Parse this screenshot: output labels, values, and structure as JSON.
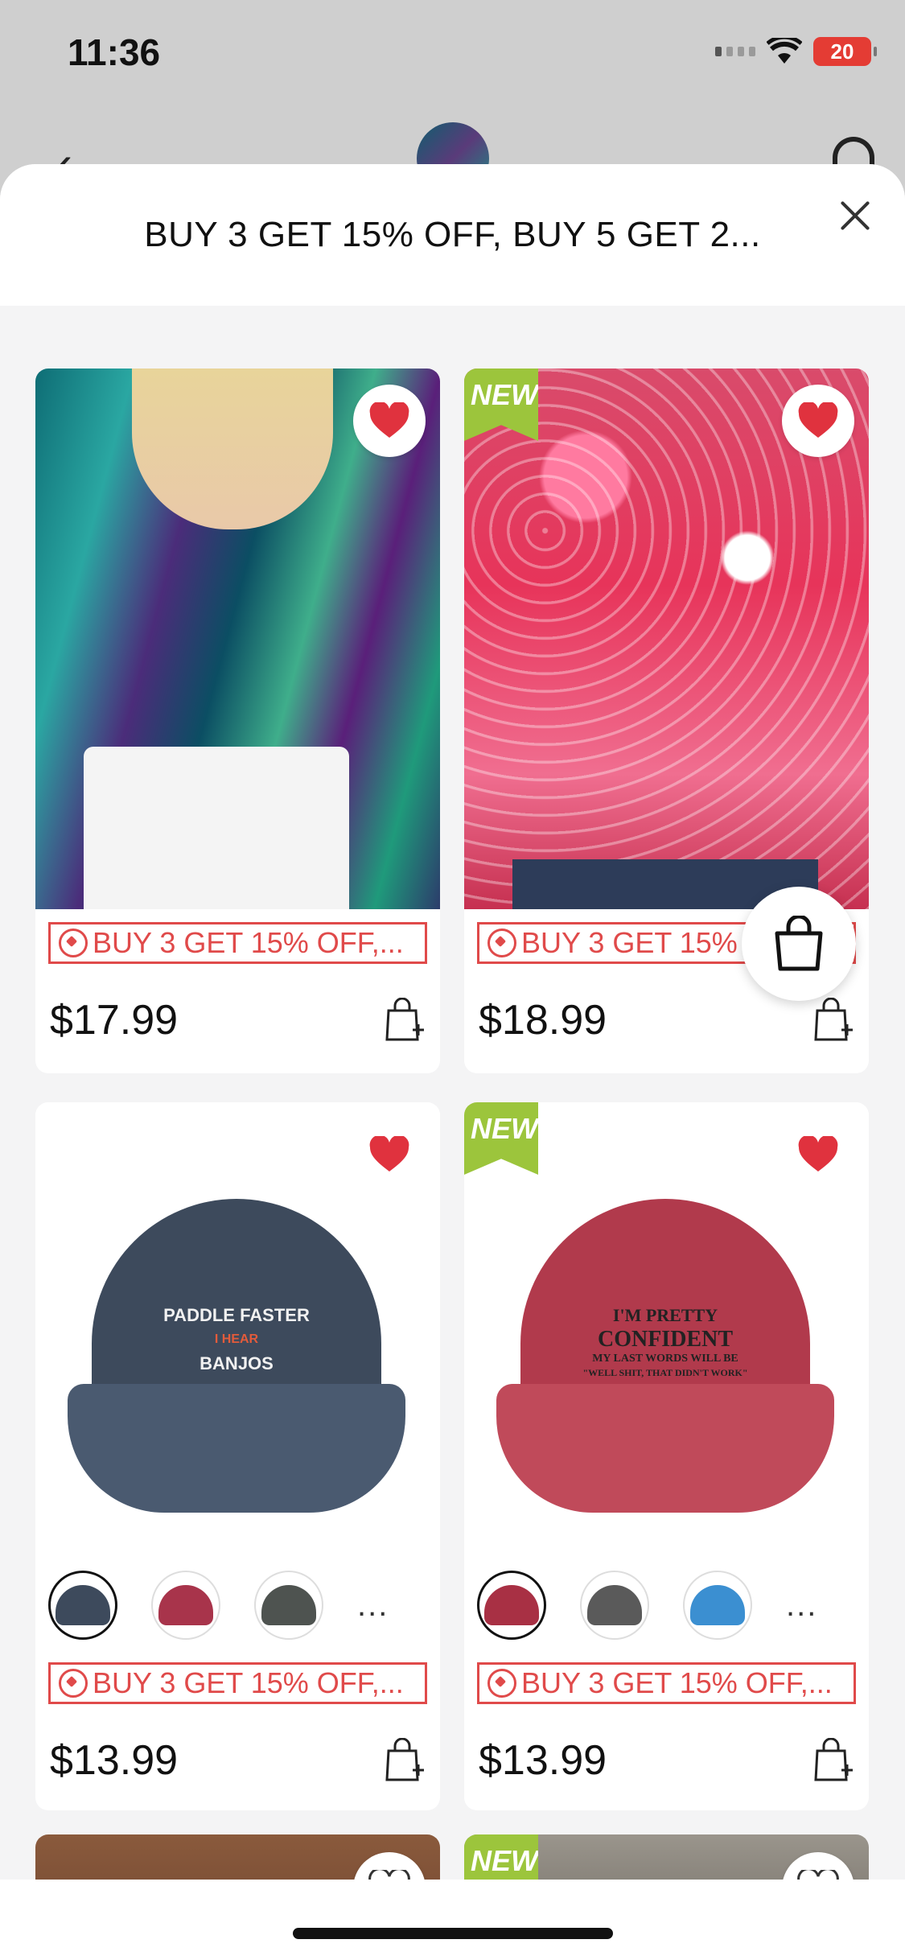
{
  "status_bar": {
    "time": "11:36",
    "battery": "20"
  },
  "sheet": {
    "title": "BUY 3 GET 15% OFF, BUY 5 GET 2..."
  },
  "products": [
    {
      "new": false,
      "promo": "BUY 3 GET 15% OFF,...",
      "price": "$17.99"
    },
    {
      "new": true,
      "new_label": "NEW",
      "promo": "BUY 3 GET 15% OFF,...",
      "price": "$18.99"
    },
    {
      "new": false,
      "promo": "BUY 3 GET 15% OFF,...",
      "price": "$13.99",
      "cap_text": [
        "PADDLE FASTER",
        "I HEAR",
        "BANJOS"
      ],
      "swatches": [
        "#3d4a5c",
        "#a8344b",
        "#4e5350"
      ],
      "more": "..."
    },
    {
      "new": true,
      "new_label": "NEW",
      "promo": "BUY 3 GET 15% OFF,...",
      "price": "$13.99",
      "cap_text": [
        "I'M PRETTY",
        "CONFIDENT",
        "MY LAST WORDS WILL BE",
        "\"WELL SHIT, THAT DIDN'T WORK\""
      ],
      "swatches": [
        "#a83044",
        "#5a5a5a",
        "#3b8fd1"
      ],
      "more": "..."
    }
  ],
  "next_row": {
    "new_label": "NEW"
  },
  "colors": {
    "promo_red": "#e04a4a",
    "heart_red": "#e0323e",
    "new_green": "#9cc53c"
  },
  "icons": [
    "back-arrow-icon",
    "headset-icon",
    "close-icon",
    "heart-icon",
    "add-to-cart-icon",
    "shopping-bag-icon",
    "coupon-tag-icon"
  ]
}
